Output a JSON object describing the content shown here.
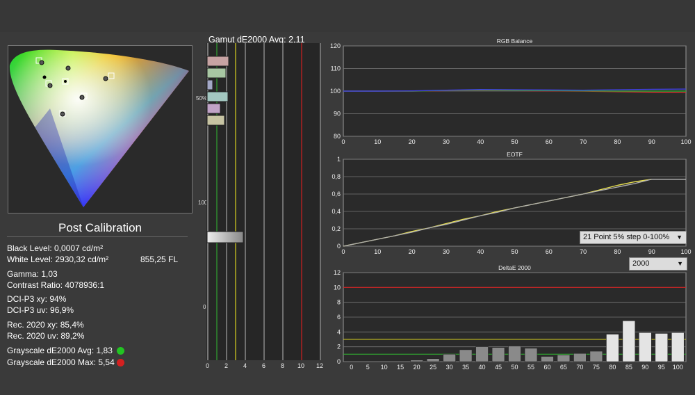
{
  "left": {
    "title": "Post Calibration",
    "black_level": "Black Level: 0,0007 cd/m²",
    "white_level": "White Level: 2930,32 cd/m²",
    "white_level_fl": "855,25 FL",
    "gamma": "Gamma: 1,03",
    "contrast": "Contrast Ratio: 4078936:1",
    "dci_xy": "DCI-P3 xy: 94%",
    "dci_uv": "DCI-P3 uv: 96,9%",
    "rec_xy": "Rec. 2020 xy: 85,4%",
    "rec_uv": "Rec. 2020 uv: 89,2%",
    "gray_avg": "Grayscale dE2000 Avg: 1,83",
    "gray_max": "Grayscale dE2000 Max: 5,54",
    "gray_avg_color": "#22c322",
    "gray_max_color": "#d42020"
  },
  "gamut": {
    "title": "Gamut dE2000 Avg:  2,11",
    "y_labels": [
      "50%",
      "100",
      "0"
    ],
    "x_labels": [
      "0",
      "2",
      "4",
      "6",
      "8",
      "10",
      "12"
    ]
  },
  "dropdowns": {
    "eotf_step": "21 Point 5% step 0-100%",
    "de_standard": "2000"
  },
  "chart_data": [
    {
      "type": "line",
      "title": "RGB Balance",
      "xlabel": "",
      "ylabel": "",
      "xlim": [
        0,
        100
      ],
      "ylim": [
        80,
        120
      ],
      "x_ticks": [
        0,
        10,
        20,
        30,
        40,
        50,
        60,
        70,
        80,
        90,
        100
      ],
      "y_ticks": [
        80,
        90,
        100,
        110,
        120
      ],
      "x": [
        0,
        10,
        20,
        30,
        40,
        50,
        60,
        70,
        80,
        90,
        100
      ],
      "series": [
        {
          "color": "#d03030",
          "values": [
            100,
            100,
            100,
            100.2,
            100.3,
            100.2,
            100.1,
            100,
            99.7,
            99.5,
            99.4
          ]
        },
        {
          "color": "#30a030",
          "values": [
            100,
            100,
            100,
            100.3,
            100.4,
            100.3,
            100.2,
            100.1,
            100,
            100,
            100
          ]
        },
        {
          "color": "#4040e0",
          "values": [
            100,
            100,
            100.1,
            100.4,
            100.7,
            100.6,
            100.5,
            100.4,
            100.6,
            100.8,
            100.9
          ]
        }
      ]
    },
    {
      "type": "line",
      "title": "EOTF",
      "xlabel": "",
      "ylabel": "",
      "xlim": [
        0,
        100
      ],
      "ylim": [
        0,
        1
      ],
      "x_ticks": [
        0,
        10,
        20,
        30,
        40,
        50,
        60,
        70,
        80,
        90,
        100
      ],
      "y_ticks": [
        0,
        0.2,
        0.4,
        0.6,
        0.8,
        1
      ],
      "y_tick_labels": [
        "0",
        "0,2",
        "0,4",
        "0,6",
        "0,8",
        "1"
      ],
      "x": [
        0,
        5,
        10,
        15,
        20,
        25,
        30,
        35,
        40,
        45,
        50,
        55,
        60,
        65,
        70,
        75,
        80,
        85,
        90,
        95,
        100
      ],
      "series": [
        {
          "color": "#e8e050",
          "values": [
            0,
            0.04,
            0.08,
            0.12,
            0.17,
            0.21,
            0.26,
            0.31,
            0.35,
            0.4,
            0.44,
            0.48,
            0.52,
            0.56,
            0.6,
            0.65,
            0.7,
            0.74,
            0.77,
            0.77,
            0.77
          ]
        },
        {
          "color": "#b0b0b0",
          "values": [
            0,
            0.04,
            0.08,
            0.12,
            0.16,
            0.21,
            0.25,
            0.3,
            0.35,
            0.39,
            0.44,
            0.48,
            0.52,
            0.56,
            0.6,
            0.64,
            0.68,
            0.72,
            0.77,
            0.77,
            0.77
          ]
        }
      ]
    },
    {
      "type": "bar",
      "title": "DeltaE 2000",
      "xlabel": "",
      "ylabel": "",
      "ylim": [
        0,
        12
      ],
      "y_ticks": [
        0,
        2,
        4,
        6,
        8,
        10,
        12
      ],
      "categories": [
        "0",
        "5",
        "10",
        "15",
        "20",
        "25",
        "30",
        "35",
        "40",
        "45",
        "50",
        "55",
        "60",
        "65",
        "70",
        "75",
        "80",
        "85",
        "90",
        "95",
        "100"
      ],
      "values": [
        0,
        0,
        0,
        0,
        0.2,
        0.4,
        1,
        1.6,
        2,
        1.9,
        2.1,
        1.8,
        0.7,
        0.9,
        1.1,
        1.4,
        3.7,
        5.5,
        3.9,
        3.8,
        3.9
      ],
      "reference_lines": [
        {
          "value": 10,
          "color": "#d02020"
        },
        {
          "value": 3,
          "color": "#d8d020"
        },
        {
          "value": 1,
          "color": "#30b030"
        }
      ]
    }
  ]
}
